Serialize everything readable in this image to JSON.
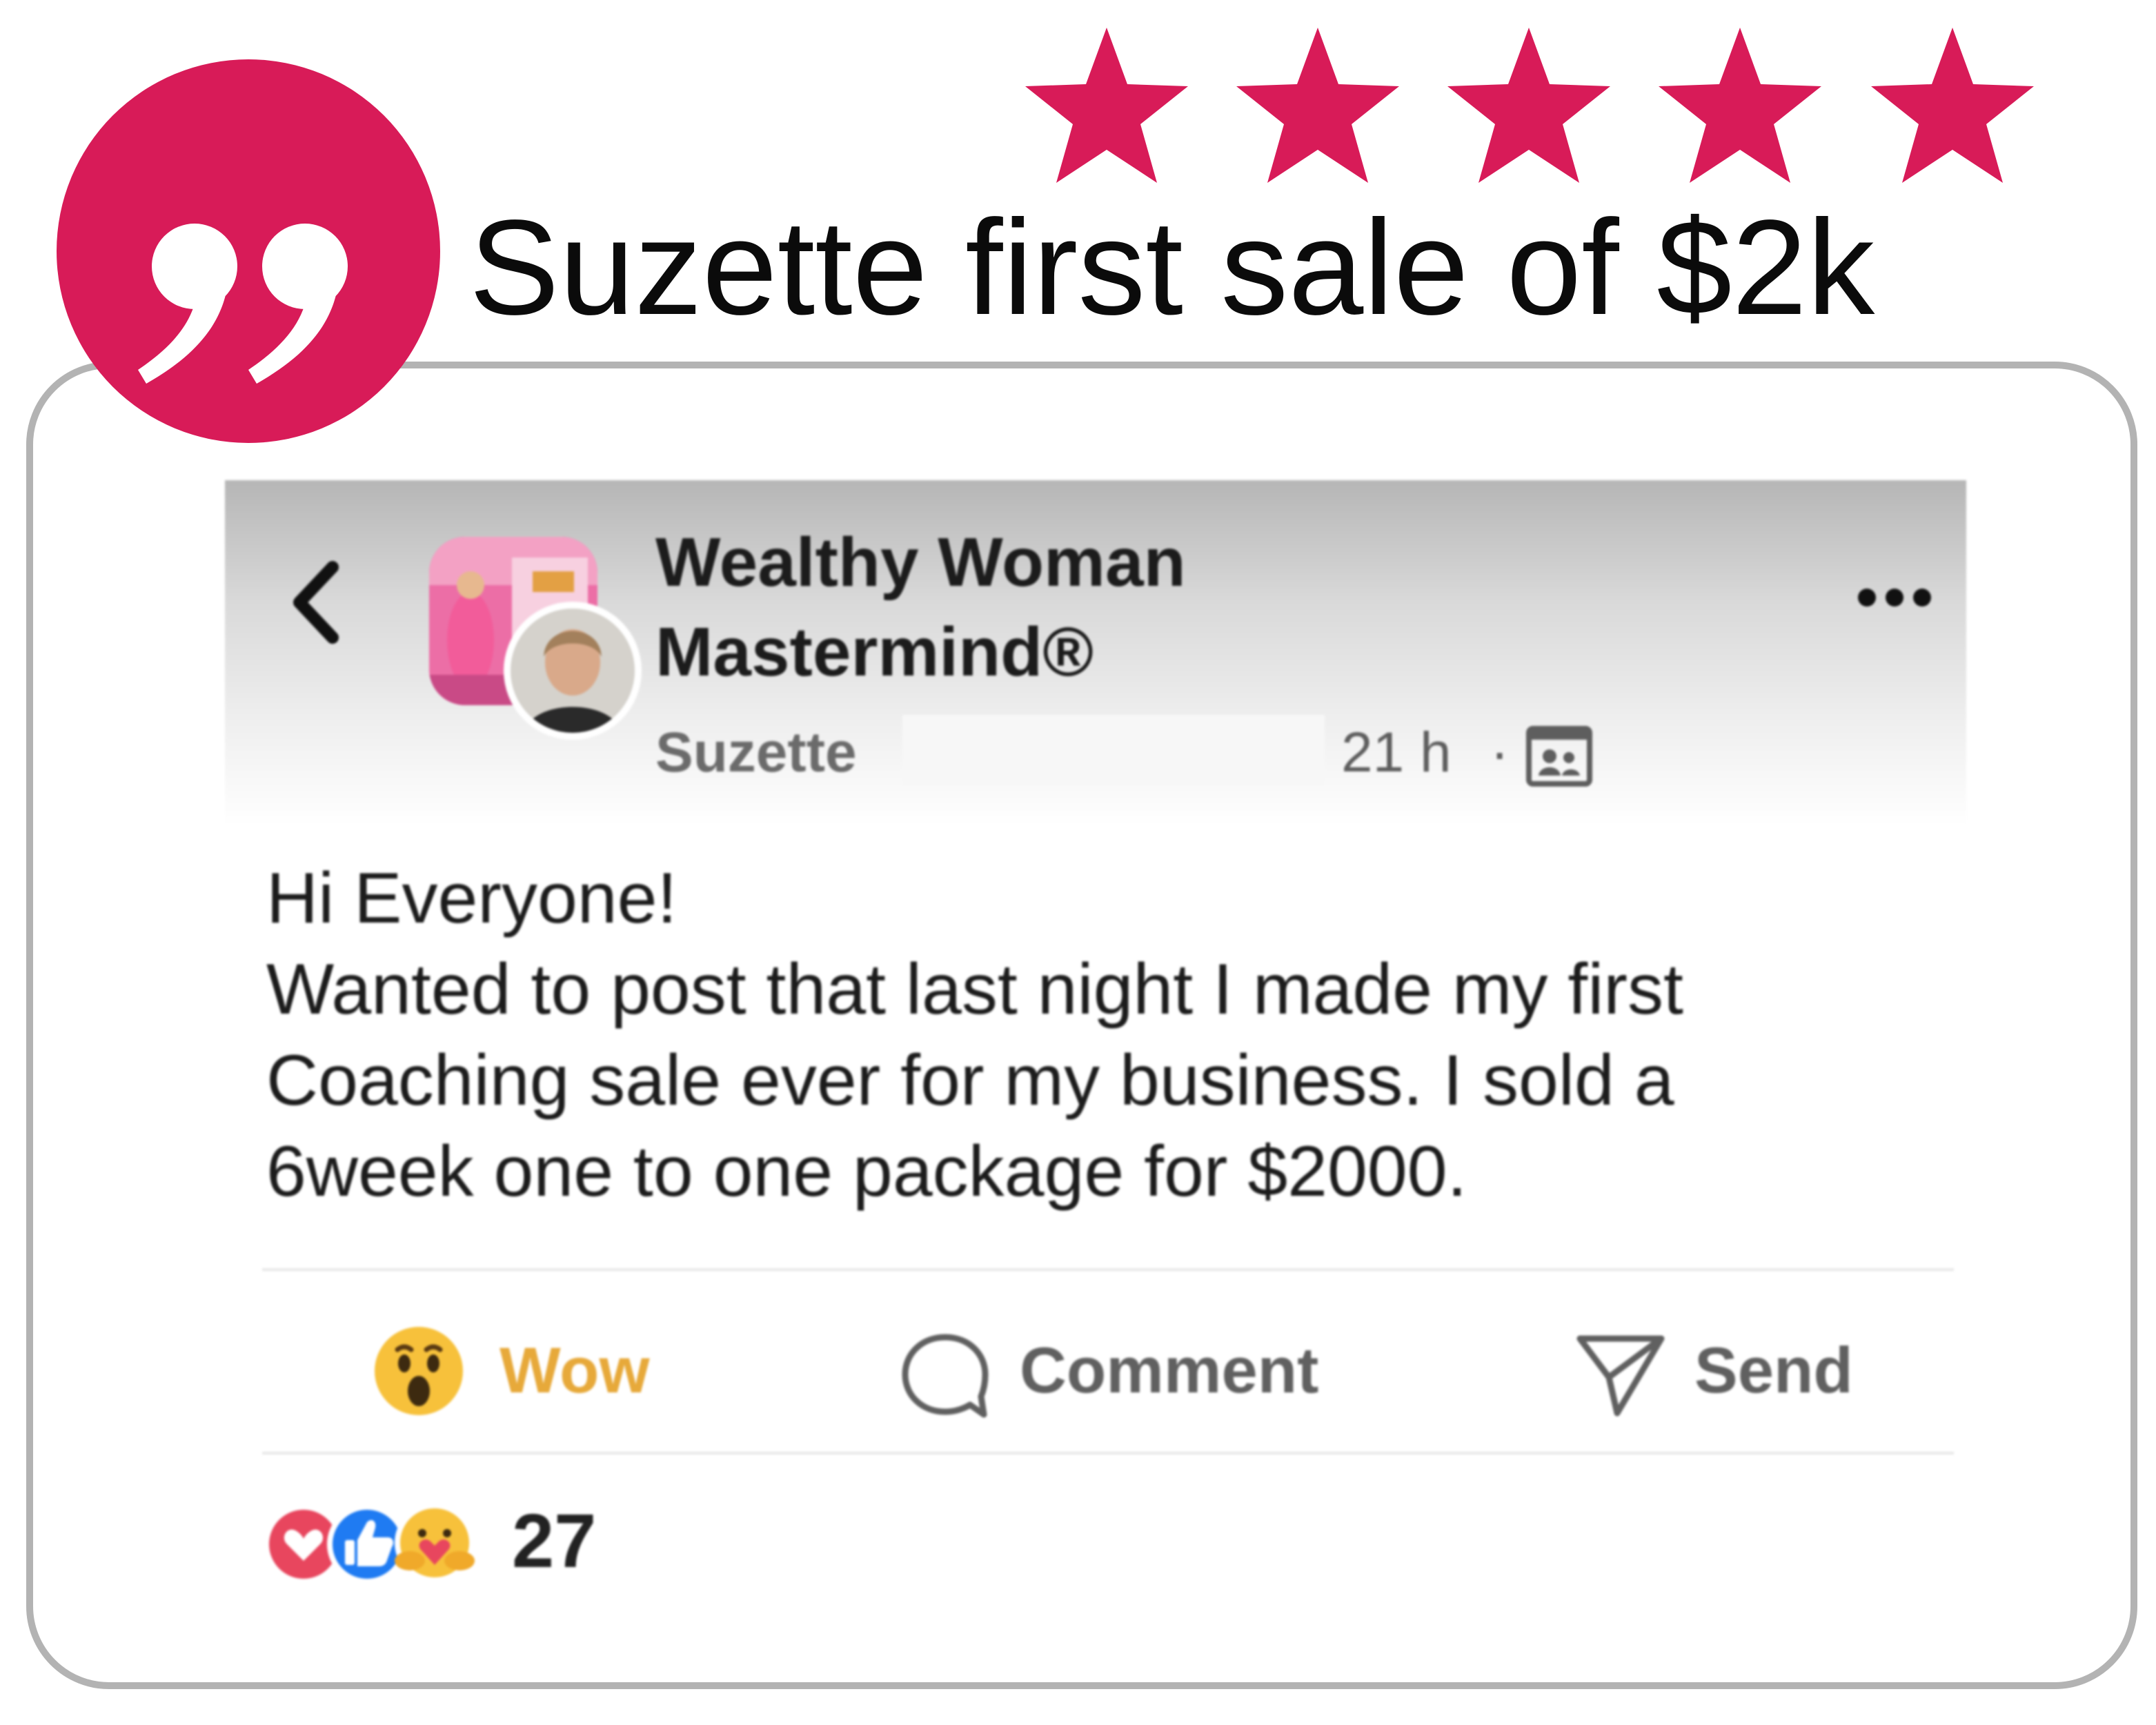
{
  "headline": "Suzette first sale of $2k",
  "rating": {
    "stars": 5,
    "max": 5,
    "color": "#d81b58"
  },
  "accent_color": "#d81b58",
  "post": {
    "group_name_line1": "Wealthy Woman",
    "group_name_line2": "Mastermind®",
    "author": "Suzette",
    "time": "21 h",
    "separator": "·",
    "body_lines": [
      "Hi Everyone!",
      "Wanted to post that last night I made my first",
      "Coaching sale ever for my business. I sold a",
      "6week one to one package for $2000."
    ],
    "actions": {
      "wow": "Wow",
      "comment": "Comment",
      "send": "Send"
    },
    "reaction_count": "27",
    "icons": {
      "back": "chevron-left-icon",
      "more": "more-horizontal-icon",
      "audience": "group-audience-icon",
      "wow": "wow-emoji-icon",
      "comment": "comment-bubble-icon",
      "send": "send-arrow-icon",
      "reactions": [
        "love-icon",
        "like-icon",
        "care-icon"
      ]
    }
  }
}
